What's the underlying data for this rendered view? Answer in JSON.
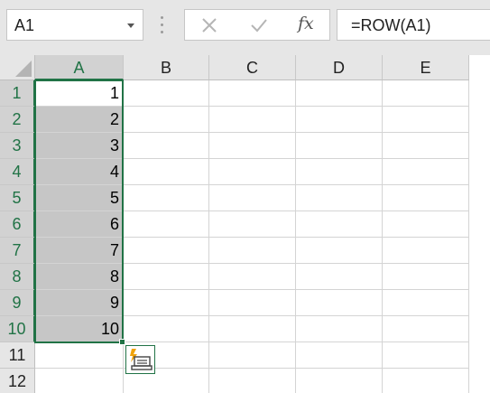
{
  "formula_bar": {
    "name_box": "A1",
    "fx_label": "fx",
    "formula": "=ROW(A1)"
  },
  "columns": [
    "A",
    "B",
    "C",
    "D",
    "E"
  ],
  "rows": [
    "1",
    "2",
    "3",
    "4",
    "5",
    "6",
    "7",
    "8",
    "9",
    "10",
    "11",
    "12"
  ],
  "cells_A": [
    "1",
    "2",
    "3",
    "4",
    "5",
    "6",
    "7",
    "8",
    "9",
    "10",
    "",
    ""
  ],
  "selection": {
    "range_label": "A1:A10",
    "active_cell": "A1"
  },
  "colors": {
    "accent": "#217346",
    "selection_fill": "#c6c6c6",
    "header_bg": "#e6e6e6"
  },
  "icons": {
    "cancel": "x-icon",
    "enter": "check-icon",
    "quick_analysis": "quick-analysis-icon"
  }
}
